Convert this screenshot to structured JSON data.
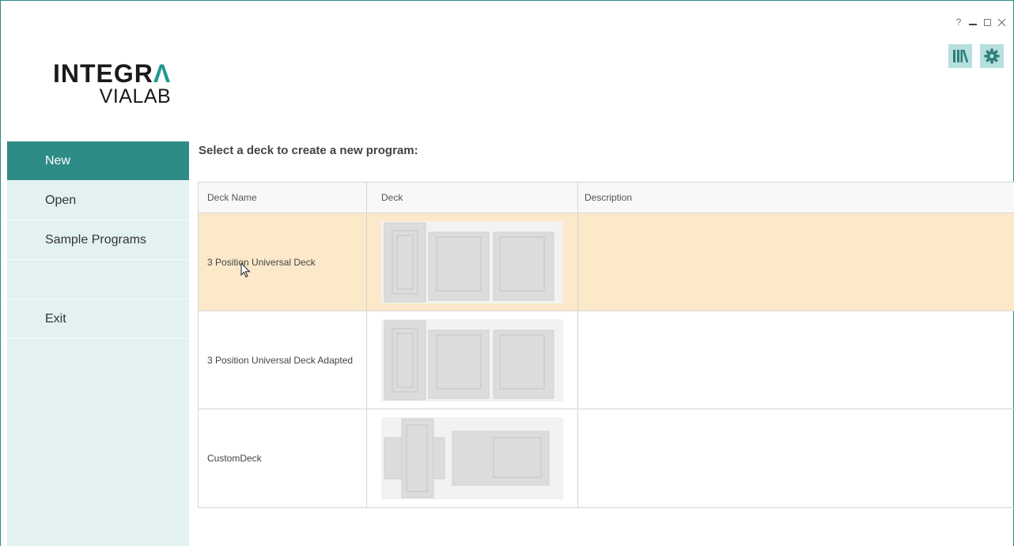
{
  "window": {
    "help_label": "?",
    "minimize_label": "minimize",
    "maximize_label": "maximize",
    "close_label": "×"
  },
  "toolbar": {
    "library_icon": "library-icon",
    "settings_icon": "gear-icon"
  },
  "logo": {
    "line1_prefix": "INTEGR",
    "line1_accent": "Λ",
    "line2": "VIALAB"
  },
  "sidebar": {
    "items": [
      {
        "label": "New",
        "active": true
      },
      {
        "label": "Open",
        "active": false
      },
      {
        "label": "Sample Programs",
        "active": false
      },
      {
        "label": "",
        "active": false
      },
      {
        "label": "Exit",
        "active": false
      }
    ]
  },
  "main": {
    "heading": "Select a deck to create a new program:",
    "table": {
      "columns": [
        "Deck Name",
        "Deck",
        "Description"
      ],
      "rows": [
        {
          "name": "3 Position Universal Deck",
          "description": "",
          "selected": true,
          "layout": "three-position"
        },
        {
          "name": "3 Position Universal Deck Adapted",
          "description": "",
          "selected": false,
          "layout": "three-position"
        },
        {
          "name": "CustomDeck",
          "description": "",
          "selected": false,
          "layout": "custom"
        }
      ]
    }
  },
  "colors": {
    "accent": "#2e8b85",
    "sidebar_bg": "#e4f1f1",
    "selected_row": "#fbe9c9",
    "tool_button": "#b5e0dd"
  }
}
